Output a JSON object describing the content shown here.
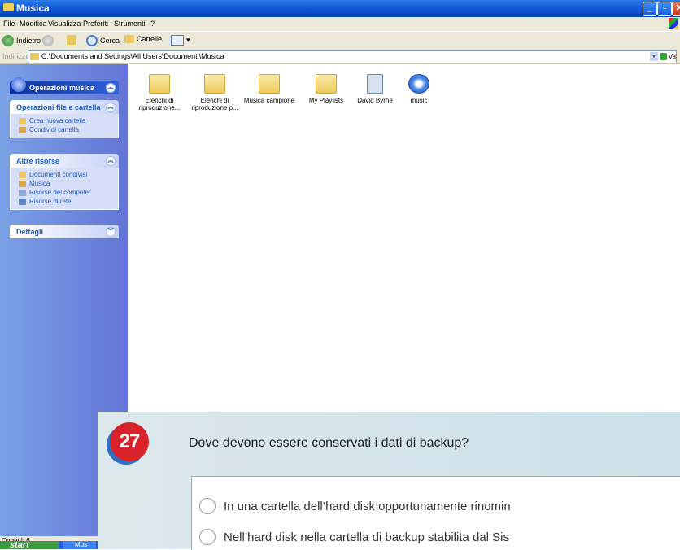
{
  "window": {
    "title": "Musica",
    "buttons": {
      "minimize": "_",
      "maximize": "▫",
      "close": "✕"
    }
  },
  "menu": [
    "File",
    "Modifica",
    "Visualizza",
    "Preferiti",
    "Strumenti",
    "?"
  ],
  "toolbar": {
    "back": "Indietro",
    "search": "Cerca",
    "folders": "Cartelle"
  },
  "address": {
    "label": "Indirizzo",
    "path": "C:\\Documents and Settings\\All Users\\Documenti\\Musica",
    "go": "Va"
  },
  "sidebar": {
    "music_tasks": {
      "title": "Operazioni musica"
    },
    "file_tasks": {
      "title": "Operazioni file e cartella",
      "items": [
        "Crea nuova cartella",
        "Condividi cartella"
      ]
    },
    "other_places": {
      "title": "Altre risorse",
      "items": [
        "Documenti condivisi",
        "Musica",
        "Risorse del computer",
        "Risorse di rete"
      ]
    },
    "details": {
      "title": "Dettagli"
    }
  },
  "files": [
    {
      "name": "Elenchi di riproduzione...",
      "type": "folder"
    },
    {
      "name": "Elenchi di riproduzione p...",
      "type": "folder"
    },
    {
      "name": "Musica campione",
      "type": "folder"
    },
    {
      "name": "My Playlists",
      "type": "folder"
    },
    {
      "name": "David Byrne",
      "type": "document"
    },
    {
      "name": "music",
      "type": "media"
    }
  ],
  "status": {
    "text": "Oggetti: 6"
  },
  "taskbar": {
    "start": "start",
    "item": "Mus"
  },
  "quiz": {
    "number": "27",
    "question": "Dove devono essere conservati i dati di backup?",
    "options": [
      "In una cartella dell’hard disk opportunamente rinomin",
      "Nell’hard disk nella cartella di backup stabilita dal Sis"
    ]
  }
}
